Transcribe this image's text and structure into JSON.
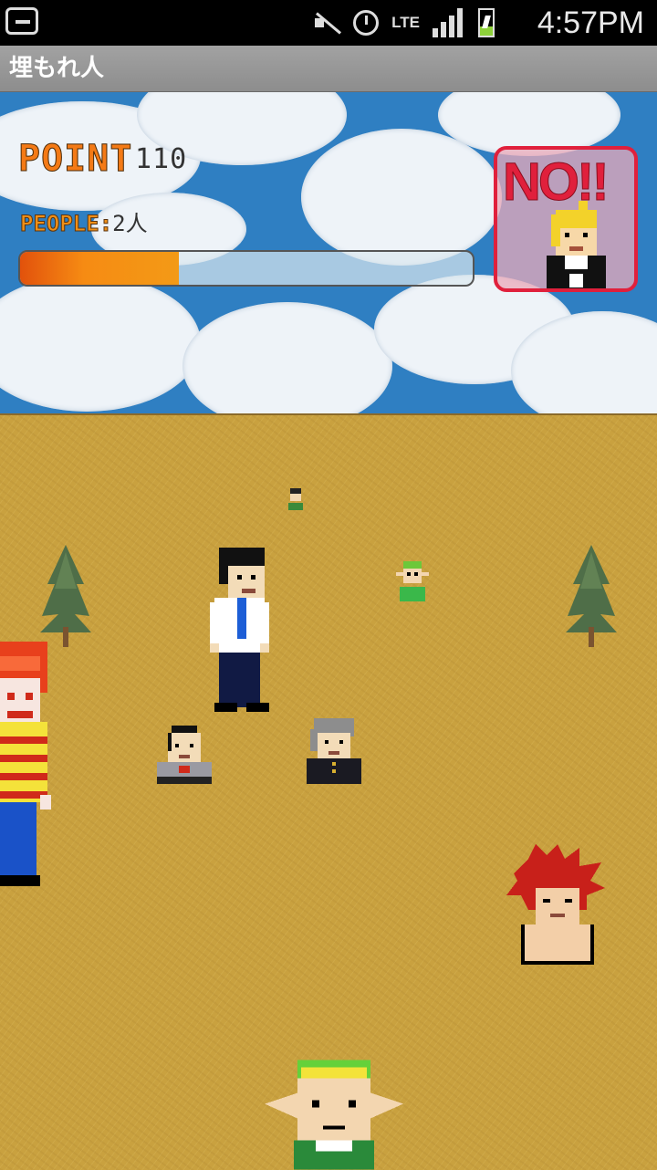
{
  "status_bar": {
    "time": "4:57PM",
    "network": "LTE",
    "icons": [
      "back-icon",
      "mute-icon",
      "alarm-icon",
      "lte-icon",
      "signal-icon",
      "battery-icon"
    ]
  },
  "app": {
    "title": "埋もれ人"
  },
  "hud": {
    "point_label": "POINT",
    "point_value": "110",
    "people_label": "PEOPLE:",
    "people_value": "2人",
    "progress_fraction": 0.35,
    "no_button_label": "NO!!"
  },
  "colors": {
    "accent_orange": "#f47a16",
    "no_red": "#e0203c",
    "sky_blue": "#2f7fc2",
    "ground": "#c9a13f"
  },
  "field": {
    "characters": [
      "tiny-dark-haired-character",
      "tree-left",
      "tree-right",
      "office-worker-character",
      "green-elf-character",
      "clown-character",
      "bald-man-character",
      "gray-haired-student-character",
      "red-haired-fighter-character",
      "large-elf-character"
    ]
  }
}
